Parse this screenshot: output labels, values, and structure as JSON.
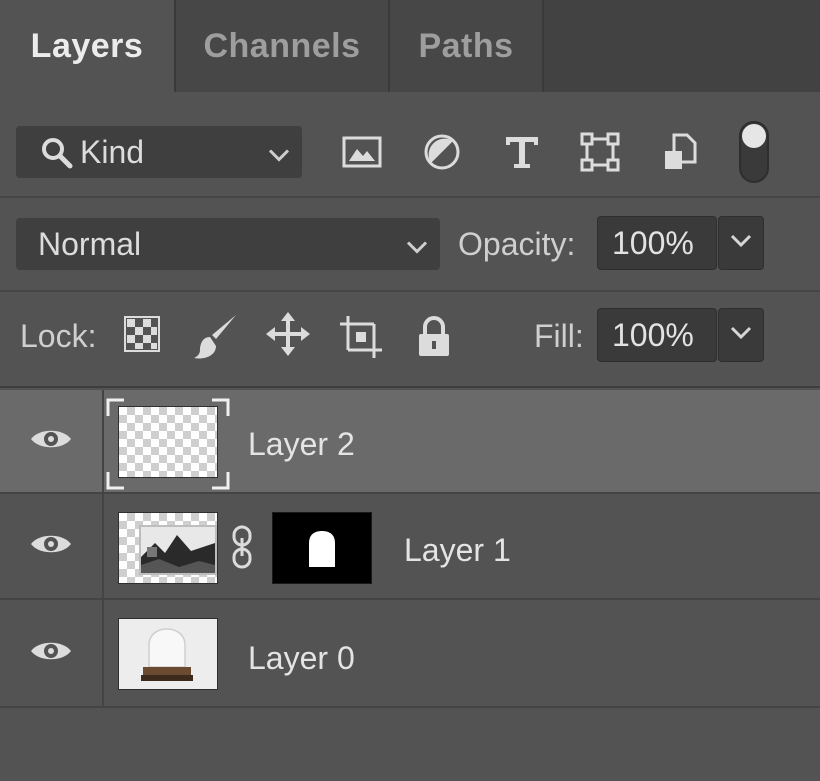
{
  "tabs": [
    {
      "label": "Layers",
      "active": true
    },
    {
      "label": "Channels",
      "active": false
    },
    {
      "label": "Paths",
      "active": false
    }
  ],
  "filter": {
    "kind_label": "Kind",
    "icons": [
      "image-filter-icon",
      "adjustment-filter-icon",
      "type-filter-icon",
      "shape-filter-icon",
      "smart-object-filter-icon",
      "filter-toggle-icon"
    ]
  },
  "blend": {
    "mode": "Normal",
    "opacity_label": "Opacity:",
    "opacity_value": "100%"
  },
  "lock": {
    "label": "Lock:",
    "icons": [
      "lock-transparent-pixels-icon",
      "lock-image-pixels-icon",
      "lock-position-icon",
      "lock-artboard-icon",
      "lock-all-icon"
    ],
    "fill_label": "Fill:",
    "fill_value": "100%"
  },
  "layers": [
    {
      "name": "Layer 2",
      "selected": true,
      "visible": true,
      "has_mask": false
    },
    {
      "name": "Layer 1",
      "selected": false,
      "visible": true,
      "has_mask": true
    },
    {
      "name": "Layer 0",
      "selected": false,
      "visible": true,
      "has_mask": false
    }
  ],
  "colors": {
    "panel_bg": "#535353",
    "tabbar_bg": "#424242",
    "selected_row": "#6a6a6a",
    "field_bg": "#3a3a3a"
  }
}
